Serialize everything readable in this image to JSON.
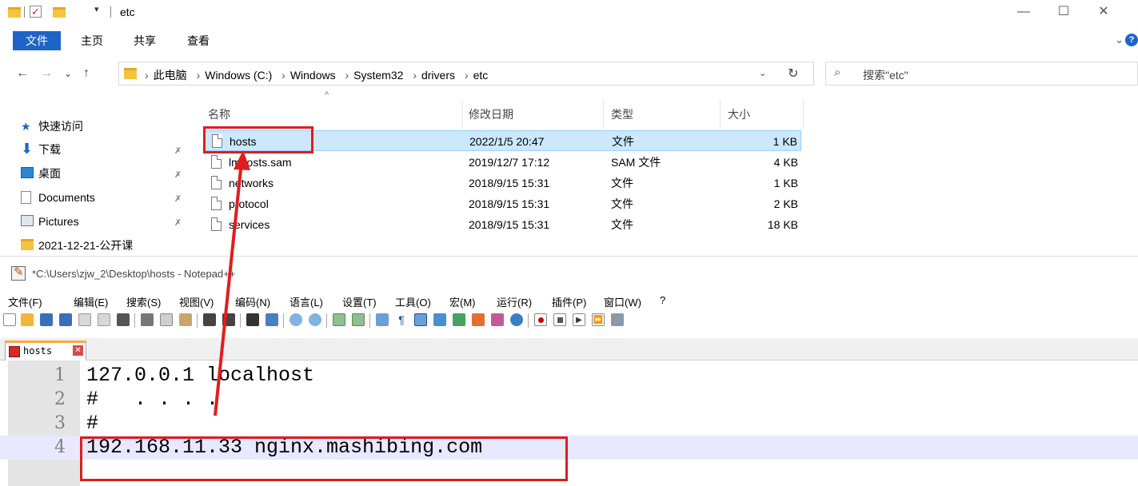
{
  "explorer": {
    "window_title": "etc",
    "window_buttons": [
      "—",
      "☐",
      "✕"
    ],
    "ribbon_tabs": [
      "文件",
      "主页",
      "共享",
      "查看"
    ],
    "ribbon_expand": "⌄",
    "help": "?",
    "nav": {
      "back": "←",
      "forward": "→",
      "recent": "⌄",
      "up": "↑"
    },
    "breadcrumb": [
      "此电脑",
      "Windows (C:)",
      "Windows",
      "System32",
      "drivers",
      "etc"
    ],
    "breadcrumb_sep": "›",
    "address_dropdown": "⌄",
    "refresh": "↻",
    "search": {
      "placeholder": "搜索\"etc\"",
      "icon": "⌕"
    },
    "sidebar": [
      {
        "label": "快速访问",
        "icon": "star-icon",
        "color": "#1e64c8"
      },
      {
        "label": "下载",
        "icon": "download-icon",
        "color": "#1e64c8",
        "pinned": true
      },
      {
        "label": "桌面",
        "icon": "desktop-icon",
        "color": "#2a87d6",
        "pinned": true
      },
      {
        "label": "Documents",
        "icon": "document-icon",
        "color": "#7a8a99",
        "pinned": true
      },
      {
        "label": "Pictures",
        "icon": "pictures-icon",
        "color": "#5a7a99",
        "pinned": true
      },
      {
        "label": "2021-12-21-公开课",
        "icon": "folder-icon",
        "color": "#f4c440"
      }
    ],
    "pin_glyph": "✗",
    "columns": [
      "名称",
      "修改日期",
      "类型",
      "大小"
    ],
    "sort_glyph": "^",
    "files": [
      {
        "name": "hosts",
        "date": "2022/1/5 20:47",
        "type": "文件",
        "size": "1 KB",
        "selected": true
      },
      {
        "name": "lmhosts.sam",
        "date": "2019/12/7 17:12",
        "type": "SAM 文件",
        "size": "4 KB"
      },
      {
        "name": "networks",
        "date": "2018/9/15 15:31",
        "type": "文件",
        "size": "1 KB"
      },
      {
        "name": "protocol",
        "date": "2018/9/15 15:31",
        "type": "文件",
        "size": "2 KB"
      },
      {
        "name": "services",
        "date": "2018/9/15 15:31",
        "type": "文件",
        "size": "18 KB"
      }
    ]
  },
  "notepad": {
    "title": "*C:\\Users\\zjw_2\\Desktop\\hosts - Notepad++",
    "menu": [
      "文件(F)",
      "编辑(E)",
      "搜索(S)",
      "视图(V)",
      "编码(N)",
      "语言(L)",
      "设置(T)",
      "工具(O)",
      "宏(M)",
      "运行(R)",
      "插件(P)",
      "窗口(W)",
      "?"
    ],
    "tab": {
      "label": "hosts",
      "close": "✕"
    },
    "lines": [
      {
        "num": "1",
        "text": "127.0.0.1 localhost"
      },
      {
        "num": "2",
        "text": "#   . . . ."
      },
      {
        "num": "3",
        "text": "#"
      },
      {
        "num": "4",
        "text": "192.168.11.33 nginx.mashibing.com",
        "active": true
      }
    ]
  },
  "annotation_color": "#e21c1c"
}
